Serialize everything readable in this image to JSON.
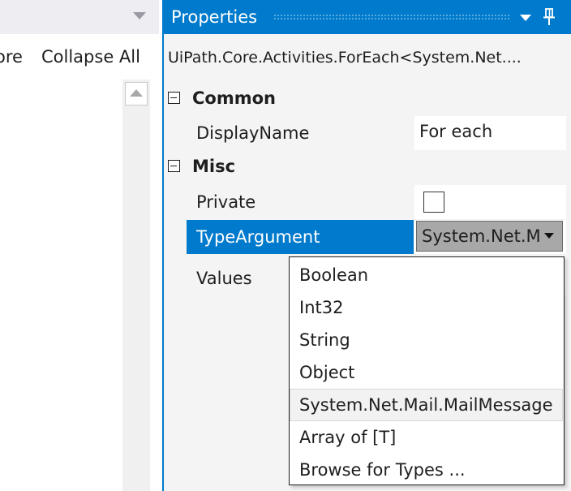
{
  "left_pane": {
    "toolbar_partial": "ore",
    "collapse_all": "Collapse All"
  },
  "properties": {
    "title": "Properties",
    "activity_type": "UiPath.Core.Activities.ForEach<System.Net....",
    "categories": [
      {
        "name": "Common",
        "properties": [
          {
            "name": "DisplayName",
            "value": "For each"
          }
        ]
      },
      {
        "name": "Misc",
        "properties": [
          {
            "name": "Private",
            "value": "",
            "checked": false
          },
          {
            "name": "TypeArgument",
            "value": "System.Net.Mail.MailMessage",
            "selected": true
          },
          {
            "name": "Values",
            "value": ""
          }
        ]
      }
    ]
  },
  "dropdown": {
    "options": [
      "Boolean",
      "Int32",
      "String",
      "Object",
      "System.Net.Mail.MailMessage",
      "Array of [T]",
      "Browse for Types ..."
    ],
    "highlighted_option": "System.Net.Mail.MailMessage"
  },
  "colors": {
    "accent": "#007acc",
    "selection_text": "#ffffff",
    "combo_bg": "#a8a8a8"
  }
}
